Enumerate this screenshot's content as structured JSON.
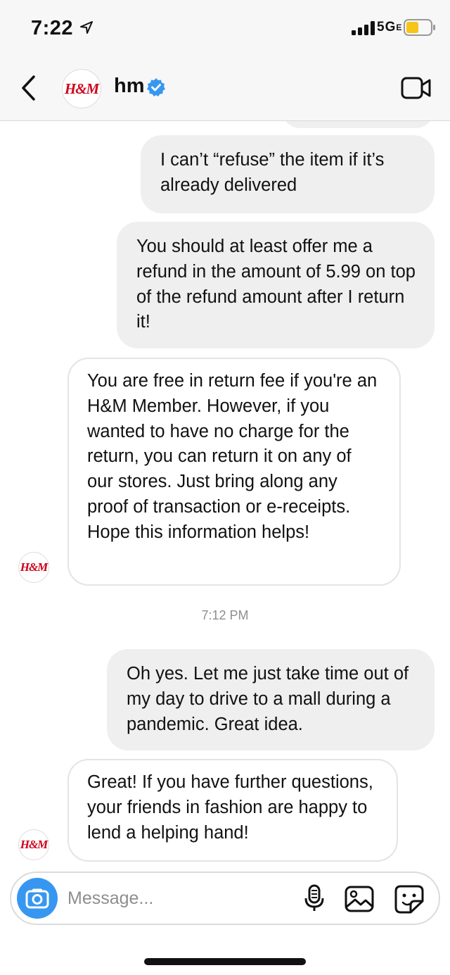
{
  "status_bar": {
    "time": "7:22",
    "network": "5G",
    "network_suffix": "E"
  },
  "header": {
    "avatar_logo": "H&M",
    "name": "hm"
  },
  "messages": [
    {
      "direction": "outgoing",
      "text": "I can’t “refuse” the item if it’s already delivered"
    },
    {
      "direction": "outgoing",
      "text": "You should at least offer me a refund in the amount of 5.99 on top of the refund amount after I return it!"
    },
    {
      "direction": "incoming",
      "text": "You are free in return fee if you're an H&M Member. However, if you wanted to have no charge for the return, you can return it on any of our stores. Just bring along  any proof of transaction or e-receipts. Hope this information helps!"
    },
    {
      "direction": "outgoing",
      "text": "Oh yes. Let me just take time out of my day to drive to a mall during a pandemic. Great idea."
    },
    {
      "direction": "incoming",
      "text": "Great! If you have further questions, your friends in fashion are happy to lend a helping hand!"
    }
  ],
  "timestamp": "7:12 PM",
  "composer": {
    "placeholder": "Message..."
  },
  "colors": {
    "accent": "#3797f0",
    "brand_red": "#d0021b",
    "battery": "#f5c518",
    "outgoing_bubble": "#efefef"
  },
  "icons": [
    "location-arrow-icon",
    "signal-bars-icon",
    "battery-icon",
    "back-chevron-icon",
    "verified-badge-icon",
    "video-call-icon",
    "camera-icon",
    "microphone-icon",
    "gallery-icon",
    "sticker-icon"
  ]
}
